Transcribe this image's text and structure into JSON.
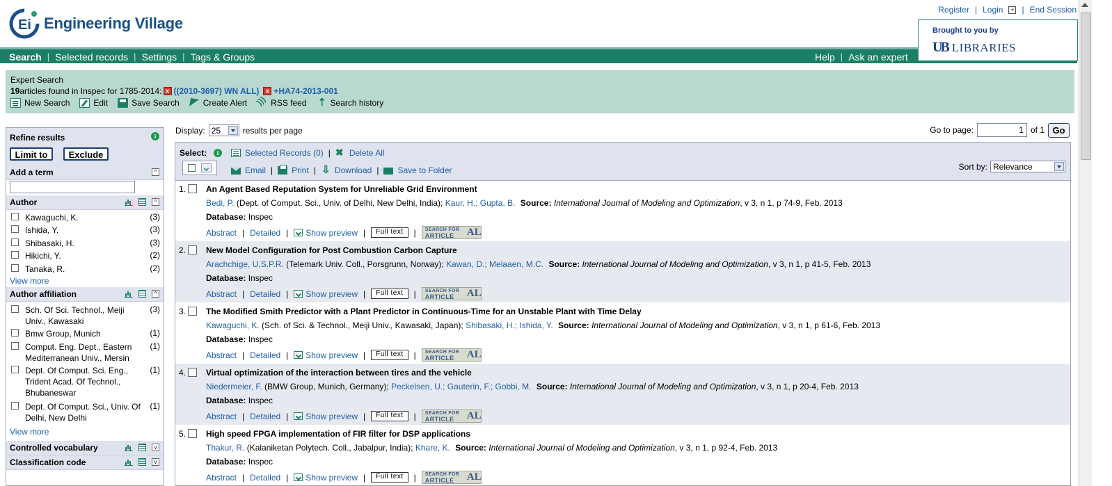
{
  "header": {
    "app_name": "Engineering Village",
    "logo_mark": "Ei",
    "top_links": [
      "Register",
      "Login",
      "End Session"
    ],
    "brought_by": "Brought to you by",
    "library_mark": "UB",
    "library_name": "LIBRARIES"
  },
  "nav": {
    "left": [
      "Search",
      "Selected records",
      "Settings",
      "Tags & Groups"
    ],
    "right": [
      "Help",
      "Ask an expert"
    ]
  },
  "expert": {
    "title": "Expert Search",
    "count": "19",
    "found_text": " articles found in Inspec for 1785-2014:",
    "query1": "((2010-3697) WN ALL)",
    "query2": "+HA74-2013-001",
    "actions": [
      "New Search",
      "Edit",
      "Save Search",
      "Create Alert",
      "RSS feed",
      "Search history"
    ]
  },
  "sidebar": {
    "refine_title": "Refine results",
    "limit_btn": "Limit to",
    "exclude_btn": "Exclude",
    "add_term": "Add a term",
    "author_title": "Author",
    "authors": [
      {
        "name": "Kawaguchi, K.",
        "count": "(3)"
      },
      {
        "name": "Ishida, Y.",
        "count": "(3)"
      },
      {
        "name": "Shibasaki, H.",
        "count": "(3)"
      },
      {
        "name": "Hikichi, Y.",
        "count": "(2)"
      },
      {
        "name": "Tanaka, R.",
        "count": "(2)"
      }
    ],
    "view_more": "View more",
    "affil_title": "Author affiliation",
    "affiliations": [
      {
        "name": "Sch. Of Sci. Technol., Meiji Univ., Kawasaki",
        "count": "(3)"
      },
      {
        "name": "Bmw Group, Munich",
        "count": "(1)"
      },
      {
        "name": "Comput. Eng. Dept., Eastern Mediterranean Univ., Mersin",
        "count": "(1)"
      },
      {
        "name": "Dept. Of Comput. Sci. Eng., Trident Acad. Of Technol., Bhubaneswar",
        "count": "(1)"
      },
      {
        "name": "Dept. Of Comput. Sci., Univ. Of Delhi, New Delhi",
        "count": "(1)"
      }
    ],
    "controlled_title": "Controlled vocabulary",
    "classification_title": "Classification code"
  },
  "display": {
    "label": "Display:",
    "value": "25",
    "suffix": "results per page",
    "goto_label": "Go to page:",
    "page": "1",
    "of": "of 1",
    "go": "Go"
  },
  "toolbar": {
    "select_label": "Select:",
    "selected_records": "Selected Records (0)",
    "delete_all": "Delete All",
    "email": "Email",
    "print": "Print",
    "download": "Download",
    "save_folder": "Save to Folder",
    "sort_label": "Sort by:",
    "sort_value": "Relevance"
  },
  "result_labels": {
    "source": "Source:",
    "database": "Database:",
    "abstract": "Abstract",
    "detailed": "Detailed",
    "show_preview": "Show preview",
    "full_text": "Full text",
    "badge_top": "SEARCH FOR",
    "badge_bottom": "ARTICLE",
    "badge_logo": "AL"
  },
  "results": [
    {
      "num": "1.",
      "title": "An Agent Based Reputation System for Unreliable Grid Environment",
      "a1": "Bedi, P.",
      "a1_aff": " (Dept. of Comput. Sci., Univ. of Delhi, New Delhi, India);",
      "a_rest": "Kaur, H.; Gupta, B.",
      "journal": "International Journal of Modeling and Optimization",
      "details": ", v 3, n 1, p 74-9, Feb. 2013",
      "db": "Inspec"
    },
    {
      "num": "2.",
      "title": "New Model Configuration for Post Combustion Carbon Capture",
      "a1": "Arachchige, U.S.P.R.",
      "a1_aff": " (Telemark Univ. Coll., Porsgrunn, Norway);",
      "a_rest": "Kawan, D.; Melaaen, M.C.",
      "journal": "International Journal of Modeling and Optimization",
      "details": ", v 3, n 1, p 41-5, Feb. 2013",
      "db": "Inspec"
    },
    {
      "num": "3.",
      "title": "The Modified Smith Predictor with a Plant Predictor in Continuous-Time for an Unstable Plant with Time Delay",
      "a1": "Kawaguchi, K.",
      "a1_aff": " (Sch. of Sci. & Technol., Meiji Univ., Kawasaki, Japan);",
      "a_rest": "Shibasaki, H.; Ishida, Y.",
      "journal": "International Journal of Modeling and Optimization",
      "details": ", v 3, n 1, p 61-6, Feb. 2013",
      "db": "Inspec"
    },
    {
      "num": "4.",
      "title": "Virtual optimization of the interaction between tires and the vehicle",
      "a1": "Niedermeier, F.",
      "a1_aff": " (BMW Group, Munich, Germany);",
      "a_rest": "Peckelsen, U.; Gauterin, F.; Gobbi, M.",
      "journal": "International Journal of Modeling and Optimization",
      "details": ", v 3, n 1, p 20-4, Feb. 2013",
      "db": "Inspec"
    },
    {
      "num": "5.",
      "title": "High speed FPGA implementation of FIR filter for DSP applications",
      "a1": "Thakur, R.",
      "a1_aff": " (Kalaniketan Polytech. Coll., Jabalpur, India);",
      "a_rest": "Khare, K.",
      "journal": "International Journal of Modeling and Optimization",
      "details": ", v 3, n 1, p 92-4, Feb. 2013",
      "db": "Inspec"
    }
  ],
  "colors": {
    "brand_green": "#1b7f66",
    "link_blue": "#1f5fa6",
    "panel_teal": "#b9d9d0",
    "header_grey": "#dfe3ee"
  }
}
